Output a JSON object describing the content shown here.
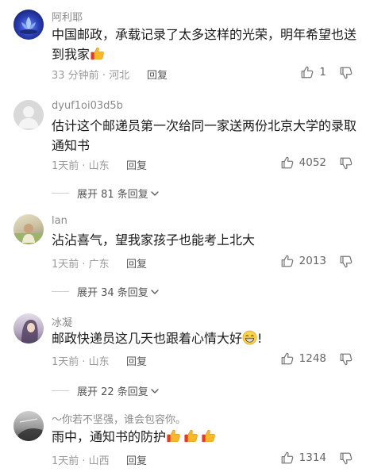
{
  "comments": [
    {
      "username": "阿利耶",
      "text": "中国邮政，承载记录了太多这样的光荣，明年希望也送到我家",
      "emoji": "thumbs-up",
      "time": "33 分钟前 · 河北",
      "reply_label": "回复",
      "likes": "1"
    },
    {
      "username": "dyuf1oi03d5b",
      "text": "估计这个邮递员第一次给同一家送两份北京大学的录取通知书",
      "time": "1天前 · 山东",
      "reply_label": "回复",
      "likes": "4052",
      "expand_label": "展开 81 条回复"
    },
    {
      "username": "lan",
      "text": "沾沾喜气，望我家孩子也能考上北大",
      "time": "1天前 · 广东",
      "reply_label": "回复",
      "likes": "2013",
      "expand_label": "展开 34 条回复"
    },
    {
      "username": "冰凝",
      "text": "邮政快递员这几天也跟着心情大好",
      "text_suffix": "!",
      "emoji": "grin",
      "time": "1天前 · 山东",
      "reply_label": "回复",
      "likes": "1248",
      "expand_label": "展开 22 条回复"
    },
    {
      "username": "～你若不坚强，谁会包容你。",
      "text": "雨中，通知书的防护",
      "emoji": "thumbs-up x3",
      "time": "1天前 · 山西",
      "reply_label": "回复",
      "likes": "1314"
    }
  ],
  "icons": {
    "like": "thumb-up-outline-icon",
    "dislike": "thumb-down-outline-icon",
    "expand": "chevron-down-icon"
  },
  "colors": {
    "username": "#8a8a8a",
    "meta": "#9a9a9a",
    "text": "#1a1a1a"
  }
}
